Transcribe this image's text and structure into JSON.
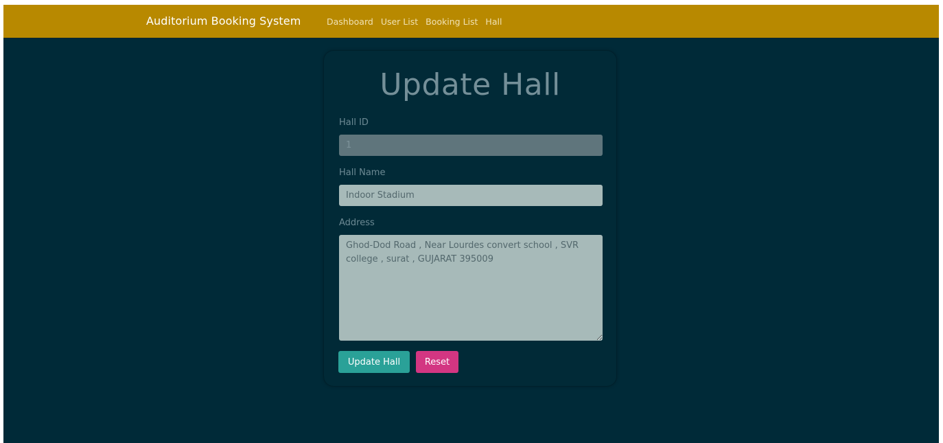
{
  "navbar": {
    "brand": "Auditorium Booking System",
    "links": [
      {
        "label": "Dashboard"
      },
      {
        "label": "User List"
      },
      {
        "label": "Booking List"
      },
      {
        "label": "Hall"
      }
    ]
  },
  "form": {
    "title": "Update Hall",
    "hall_id": {
      "label": "Hall ID",
      "value": "1"
    },
    "hall_name": {
      "label": "Hall Name",
      "value": "Indoor Stadium"
    },
    "address": {
      "label": "Address",
      "value": "Ghod-Dod Road , Near Lourdes convert school , SVR college , surat , GUJARAT 395009"
    },
    "update_button": "Update Hall",
    "reset_button": "Reset"
  },
  "colors": {
    "navbar": "#b88900",
    "background": "#002a38",
    "update_button": "#2aa198",
    "reset_button": "#d33682"
  }
}
